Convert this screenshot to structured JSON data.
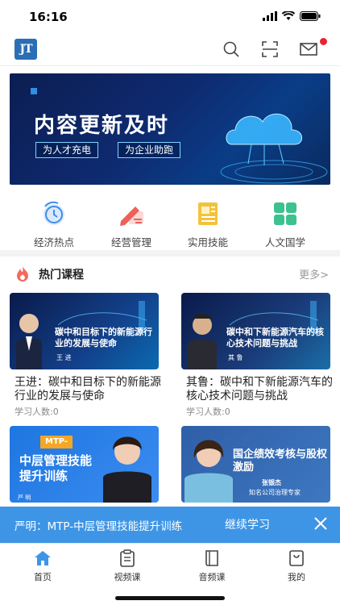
{
  "status": {
    "time": "16:16"
  },
  "header": {
    "logo_text": "JT",
    "icons": [
      "search-icon",
      "scan-icon",
      "mail-icon"
    ]
  },
  "banner": {
    "title": "内容更新及时",
    "pill_left": "为人才充电",
    "pill_right": "为企业助跑"
  },
  "categories": [
    {
      "label": "经济热点",
      "icon": "clock-icon"
    },
    {
      "label": "经营管理",
      "icon": "pencil-icon"
    },
    {
      "label": "实用技能",
      "icon": "document-icon"
    },
    {
      "label": "人文国学",
      "icon": "grid-icon"
    }
  ],
  "courses_section": {
    "title": "热门课程",
    "more": "更多>"
  },
  "courses": [
    {
      "title": "王进：碳中和目标下的新能源行业的发展与使命",
      "count": "学习人数:0",
      "thumb_text": "碳中和目标下的新能源行业的发展与使命",
      "thumb_name": "王 进"
    },
    {
      "title": "其鲁：碳中和下新能源汽车的核心技术问题与挑战",
      "count": "学习人数:0",
      "thumb_text": "碳中和下新能源汽车的核心技术问题与挑战",
      "thumb_name": "其 鲁"
    },
    {
      "thumb_tag": "MTP-",
      "thumb_text": "中层管理技能提升训练",
      "thumb_name": "严 明"
    },
    {
      "thumb_text": "国企绩效考核与股权激励",
      "thumb_name": "张银杰",
      "thumb_sub": "知名公司治理专家"
    }
  ],
  "resume": {
    "text": "严明：MTP-中层管理技能提升训练",
    "action": "继续学习"
  },
  "tabs": [
    {
      "label": "首页",
      "icon": "home-icon",
      "active": true
    },
    {
      "label": "视频课",
      "icon": "clipboard-icon",
      "active": false
    },
    {
      "label": "音频课",
      "icon": "book-icon",
      "active": false
    },
    {
      "label": "我的",
      "icon": "bag-icon",
      "active": false
    }
  ],
  "colors": {
    "accent": "#3e95e6",
    "badge": "#e8242f",
    "tab_active": "#3e95e6"
  }
}
